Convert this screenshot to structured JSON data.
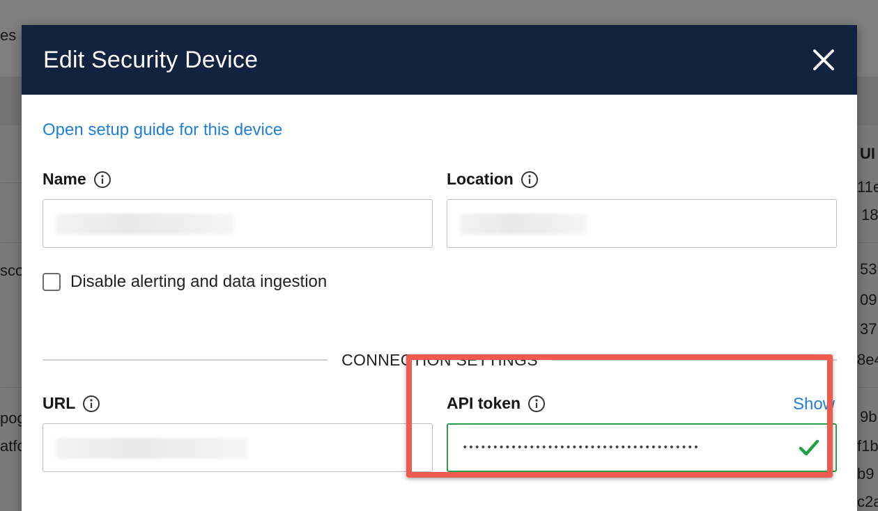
{
  "background": {
    "fragments": {
      "f1": "es",
      "f2": "UI",
      "f3": "11e",
      "f4": "18",
      "f5": "sco",
      "f6": "53",
      "f7": "09",
      "f8": "37",
      "f9": "8e4",
      "f10": "pog",
      "f11": "atfo",
      "f12": "9b",
      "f13": "f1b",
      "f14": "b9",
      "f15": "c2a"
    }
  },
  "modal": {
    "title": "Edit Security Device",
    "close_icon": "close-icon",
    "setup_link": "Open setup guide for this device",
    "name_label": "Name",
    "location_label": "Location",
    "disable_checkbox": {
      "label": "Disable alerting and data ingestion",
      "checked": false
    },
    "section_title": "CONNECTION SETTINGS",
    "url_label": "URL",
    "api_token_label": "API token",
    "show_link": "Show",
    "api_token_value": "•••••••••••••••••••••••••••••••••••••••",
    "token_status_icon": "checkmark-icon"
  },
  "colors": {
    "header_bg": "#12233f",
    "link": "#1f7fd6",
    "success": "#24a148",
    "highlight": "#f15a4f"
  }
}
